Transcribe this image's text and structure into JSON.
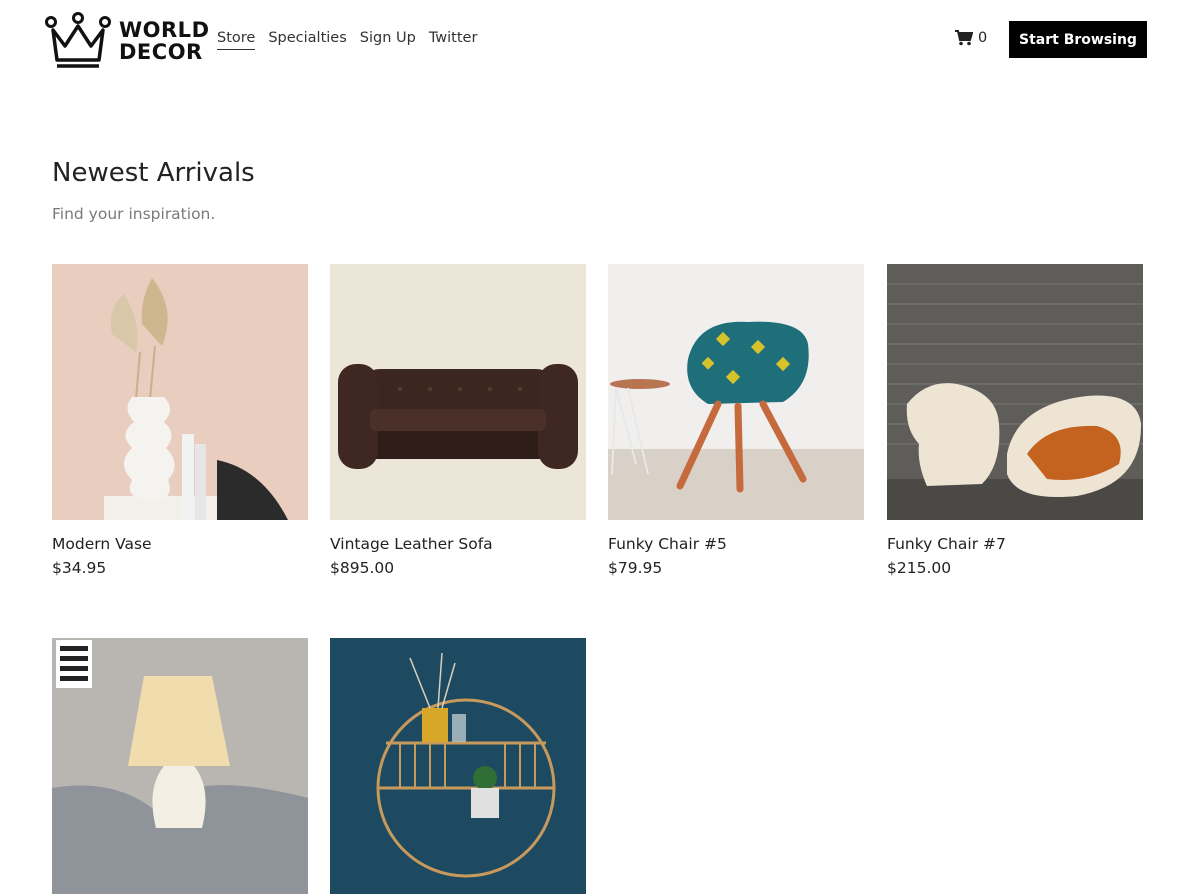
{
  "brand": {
    "line1": "WORLD",
    "line2": "DECOR"
  },
  "nav": {
    "items": [
      {
        "label": "Store",
        "active": true
      },
      {
        "label": "Specialties"
      },
      {
        "label": "Sign Up"
      },
      {
        "label": "Twitter"
      }
    ]
  },
  "cart": {
    "count": "0",
    "icon": "cart-icon"
  },
  "cta": {
    "label": "Start Browsing"
  },
  "section": {
    "title": "Newest Arrivals",
    "subtitle": "Find your inspiration."
  },
  "products": [
    {
      "name": "Modern Vase",
      "price": "$34.95"
    },
    {
      "name": "Vintage Leather Sofa",
      "price": "$895.00"
    },
    {
      "name": "Funky Chair #5",
      "price": "$79.95"
    },
    {
      "name": "Funky Chair #7",
      "price": "$215.00"
    },
    {
      "name": "",
      "price": ""
    },
    {
      "name": "",
      "price": ""
    }
  ],
  "colors": {
    "accent": "#000000",
    "text": "#222222",
    "muted": "#7a7a7a"
  }
}
